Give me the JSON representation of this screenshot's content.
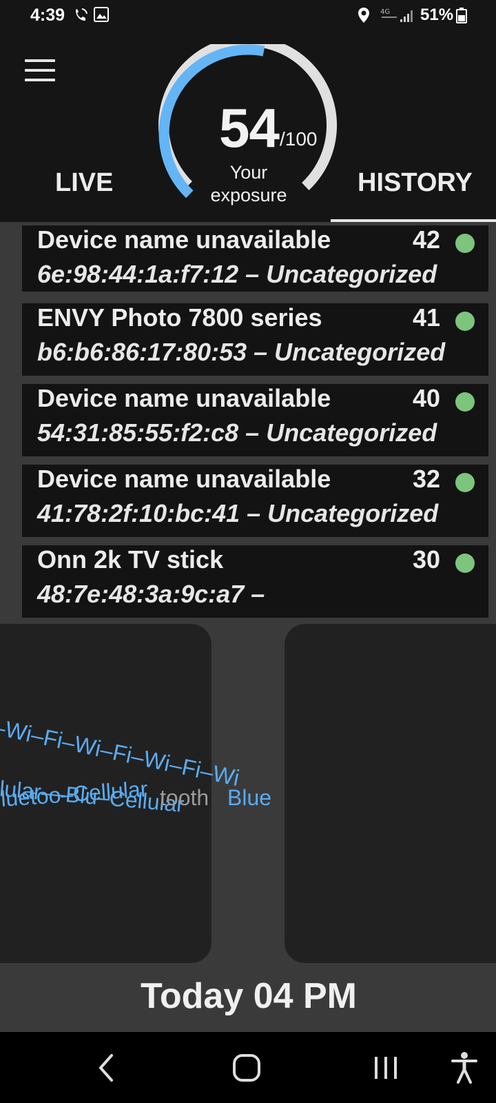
{
  "status_bar": {
    "time": "4:39",
    "battery": "51%"
  },
  "header": {
    "tab_live": "LIVE",
    "tab_history": "HISTORY",
    "selected_tab": "HISTORY",
    "exposure_score": "54",
    "exposure_max": "/100",
    "exposure_label": "Your exposure",
    "exposure_fraction": 0.54,
    "gauge_color": "#64b5f6"
  },
  "devices": [
    {
      "name": "Device name unavailable",
      "score": "42",
      "detail": "6e:98:44:1a:f7:12  – Uncategorized",
      "status_color": "#7dc47d"
    },
    {
      "name": "ENVY Photo 7800 series",
      "score": "41",
      "detail": "b6:b6:86:17:80:53  – Uncategorized",
      "status_color": "#7dc47d"
    },
    {
      "name": "Device name unavailable",
      "score": "40",
      "detail": "54:31:85:55:f2:c8  – Uncategorized",
      "status_color": "#7dc47d"
    },
    {
      "name": "Device name unavailable",
      "score": "32",
      "detail": "41:78:2f:10:bc:41  – Uncategorized",
      "status_color": "#7dc47d"
    },
    {
      "name": "Onn 2k TV stick",
      "score": "30",
      "detail": "48:7e:48:3a:9c:a7  –",
      "status_color": "#7dc47d"
    }
  ],
  "visualization": {
    "wifi_text": "–Wi–Fi–Wi–Fi–Wi–Fi–Wi",
    "cellular_text": "llular––Blu–Cellular",
    "bluetooth_text": "luetoo–Cellular",
    "bluetooth_text_2": "tooth",
    "cellular_text_2": "Blue",
    "time_label": "Today 04 PM"
  }
}
